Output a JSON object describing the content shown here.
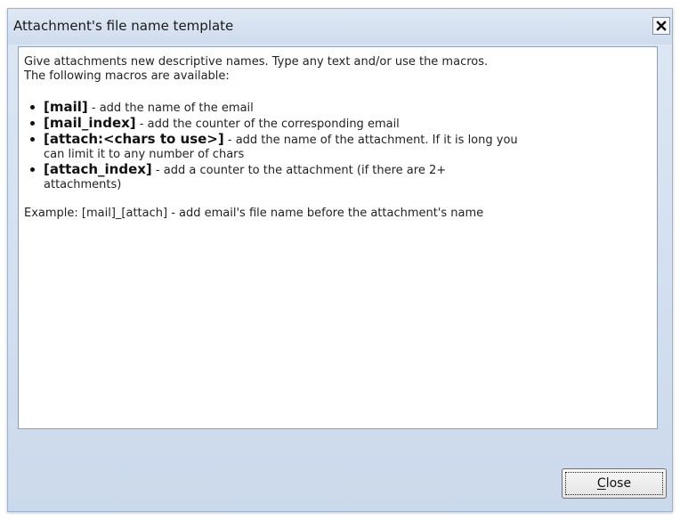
{
  "window": {
    "title": "Attachment's file name template"
  },
  "content": {
    "intro_line1": "Give attachments new descriptive names. Type any text and/or use the macros.",
    "intro_line2": "The following macros are available:",
    "macros": [
      {
        "name": "[mail]",
        "desc": " - add the name of the email"
      },
      {
        "name": "[mail_index]",
        "desc": " - add the counter of the corresponding email"
      },
      {
        "name": "[attach:<chars to use>]",
        "desc": " - add the name of the attachment. If it is long you",
        "desc2": "can limit it to any number of chars"
      },
      {
        "name": "[attach_index]",
        "desc": " - add a counter to the attachment (if there are 2+",
        "desc2": "attachments)"
      }
    ],
    "example": "Example: [mail]_[attach] - add email's file name before the attachment's name"
  },
  "footer": {
    "close_mnemonic": "C",
    "close_rest": "lose"
  }
}
